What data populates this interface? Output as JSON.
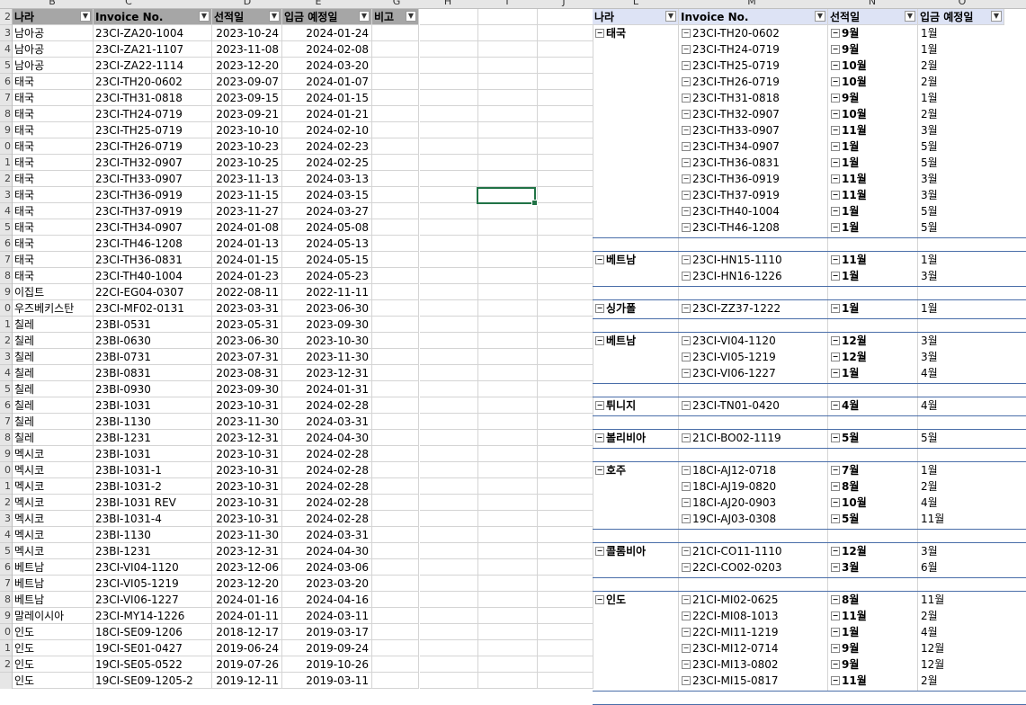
{
  "column_letters": [
    "B",
    "C",
    "D",
    "E",
    "G",
    "H",
    "I",
    "J",
    "L",
    "M",
    "N",
    "O"
  ],
  "row_numbers": [
    "2",
    "3",
    "4",
    "5",
    "6",
    "7",
    "8",
    "9",
    "0",
    "1",
    "2",
    "3",
    "4",
    "5",
    "6",
    "7",
    "8",
    "9",
    "0",
    "1",
    "2",
    "3",
    "4",
    "5",
    "6",
    "7",
    "8",
    "9",
    "0",
    "1",
    "2",
    "3",
    "4",
    "5",
    "6",
    "7",
    "8",
    "9",
    "0",
    "1",
    "2"
  ],
  "left_headers": [
    "나라",
    "Invoice No.",
    "선적일",
    "입금 예정일",
    "비고"
  ],
  "left_rows": [
    [
      "남아공",
      "23CI-ZA20-1004",
      "2023-10-24",
      "2024-01-24"
    ],
    [
      "남아공",
      "23CI-ZA21-1107",
      "2023-11-08",
      "2024-02-08"
    ],
    [
      "남아공",
      "23CI-ZA22-1114",
      "2023-12-20",
      "2024-03-20"
    ],
    [
      "태국",
      "23CI-TH20-0602",
      "2023-09-07",
      "2024-01-07"
    ],
    [
      "태국",
      "23CI-TH31-0818",
      "2023-09-15",
      "2024-01-15"
    ],
    [
      "태국",
      "23CI-TH24-0719",
      "2023-09-21",
      "2024-01-21"
    ],
    [
      "태국",
      "23CI-TH25-0719",
      "2023-10-10",
      "2024-02-10"
    ],
    [
      "태국",
      "23CI-TH26-0719",
      "2023-10-23",
      "2024-02-23"
    ],
    [
      "태국",
      "23CI-TH32-0907",
      "2023-10-25",
      "2024-02-25"
    ],
    [
      "태국",
      "23CI-TH33-0907",
      "2023-11-13",
      "2024-03-13"
    ],
    [
      "태국",
      "23CI-TH36-0919",
      "2023-11-15",
      "2024-03-15"
    ],
    [
      "태국",
      "23CI-TH37-0919",
      "2023-11-27",
      "2024-03-27"
    ],
    [
      "태국",
      "23CI-TH34-0907",
      "2024-01-08",
      "2024-05-08"
    ],
    [
      "태국",
      "23CI-TH46-1208",
      "2024-01-13",
      "2024-05-13"
    ],
    [
      "태국",
      "23CI-TH36-0831",
      "2024-01-15",
      "2024-05-15"
    ],
    [
      "태국",
      "23CI-TH40-1004",
      "2024-01-23",
      "2024-05-23"
    ],
    [
      "이집트",
      "22CI-EG04-0307",
      "2022-08-11",
      "2022-11-11"
    ],
    [
      "우즈베키스탄",
      "23CI-MF02-0131",
      "2023-03-31",
      "2023-06-30"
    ],
    [
      "칠레",
      "23BI-0531",
      "2023-05-31",
      "2023-09-30"
    ],
    [
      "칠레",
      "23BI-0630",
      "2023-06-30",
      "2023-10-30"
    ],
    [
      "칠레",
      "23BI-0731",
      "2023-07-31",
      "2023-11-30"
    ],
    [
      "칠레",
      "23BI-0831",
      "2023-08-31",
      "2023-12-31"
    ],
    [
      "칠레",
      "23BI-0930",
      "2023-09-30",
      "2024-01-31"
    ],
    [
      "칠레",
      "23BI-1031",
      "2023-10-31",
      "2024-02-28"
    ],
    [
      "칠레",
      "23BI-1130",
      "2023-11-30",
      "2024-03-31"
    ],
    [
      "칠레",
      "23BI-1231",
      "2023-12-31",
      "2024-04-30"
    ],
    [
      "멕시코",
      "23BI-1031",
      "2023-10-31",
      "2024-02-28"
    ],
    [
      "멕시코",
      "23BI-1031-1",
      "2023-10-31",
      "2024-02-28"
    ],
    [
      "멕시코",
      "23BI-1031-2",
      "2023-10-31",
      "2024-02-28"
    ],
    [
      "멕시코",
      "23BI-1031 REV",
      "2023-10-31",
      "2024-02-28"
    ],
    [
      "멕시코",
      "23BI-1031-4",
      "2023-10-31",
      "2024-02-28"
    ],
    [
      "멕시코",
      "23BI-1130",
      "2023-11-30",
      "2024-03-31"
    ],
    [
      "멕시코",
      "23BI-1231",
      "2023-12-31",
      "2024-04-30"
    ],
    [
      "베트남",
      "23CI-VI04-1120",
      "2023-12-06",
      "2024-03-06"
    ],
    [
      "베트남",
      "23CI-VI05-1219",
      "2023-12-20",
      "2023-03-20"
    ],
    [
      "베트남",
      "23CI-VI06-1227",
      "2024-01-16",
      "2024-04-16"
    ],
    [
      "말레이시아",
      "23CI-MY14-1226",
      "2024-01-11",
      "2024-03-11"
    ],
    [
      "인도",
      "18CI-SE09-1206",
      "2018-12-17",
      "2019-03-17"
    ],
    [
      "인도",
      "19CI-SE01-0427",
      "2019-06-24",
      "2019-09-24"
    ],
    [
      "인도",
      "19CI-SE05-0522",
      "2019-07-26",
      "2019-10-26"
    ],
    [
      "인도",
      "19CI-SE09-1205-2",
      "2019-12-11",
      "2019-03-11"
    ]
  ],
  "pivot_headers": [
    "나라",
    "Invoice No.",
    "선적일",
    "입금 예정일"
  ],
  "pivot_groups": [
    {
      "country": "태국",
      "rows": [
        [
          "23CI-TH20-0602",
          "9월",
          "1월"
        ],
        [
          "23CI-TH24-0719",
          "9월",
          "1월"
        ],
        [
          "23CI-TH25-0719",
          "10월",
          "2월"
        ],
        [
          "23CI-TH26-0719",
          "10월",
          "2월"
        ],
        [
          "23CI-TH31-0818",
          "9월",
          "1월"
        ],
        [
          "23CI-TH32-0907",
          "10월",
          "2월"
        ],
        [
          "23CI-TH33-0907",
          "11월",
          "3월"
        ],
        [
          "23CI-TH34-0907",
          "1월",
          "5월"
        ],
        [
          "23CI-TH36-0831",
          "1월",
          "5월"
        ],
        [
          "23CI-TH36-0919",
          "11월",
          "3월"
        ],
        [
          "23CI-TH37-0919",
          "11월",
          "3월"
        ],
        [
          "23CI-TH40-1004",
          "1월",
          "5월"
        ],
        [
          "23CI-TH46-1208",
          "1월",
          "5월"
        ]
      ]
    },
    {
      "country": "베트남",
      "rows": [
        [
          "23CI-HN15-1110",
          "11월",
          "1월"
        ],
        [
          "23CI-HN16-1226",
          "1월",
          "3월"
        ]
      ]
    },
    {
      "country": "싱가폴",
      "rows": [
        [
          "23CI-ZZ37-1222",
          "1월",
          "1월"
        ]
      ]
    },
    {
      "country": "베트남",
      "rows": [
        [
          "23CI-VI04-1120",
          "12월",
          "3월"
        ],
        [
          "23CI-VI05-1219",
          "12월",
          "3월"
        ],
        [
          "23CI-VI06-1227",
          "1월",
          "4월"
        ]
      ]
    },
    {
      "country": "튀니지",
      "rows": [
        [
          "23CI-TN01-0420",
          "4월",
          "4월"
        ]
      ]
    },
    {
      "country": "볼리비아",
      "rows": [
        [
          "21CI-BO02-1119",
          "5월",
          "5월"
        ]
      ]
    },
    {
      "country": "호주",
      "rows": [
        [
          "18CI-AJ12-0718",
          "7월",
          "1월"
        ],
        [
          "18CI-AJ19-0820",
          "8월",
          "2월"
        ],
        [
          "18CI-AJ20-0903",
          "10월",
          "4월"
        ],
        [
          "19CI-AJ03-0308",
          "5월",
          "11월"
        ]
      ]
    },
    {
      "country": "콜롬비아",
      "rows": [
        [
          "21CI-CO11-1110",
          "12월",
          "3월"
        ],
        [
          "22CI-CO02-0203",
          "3월",
          "6월"
        ]
      ]
    },
    {
      "country": "인도",
      "rows": [
        [
          "21CI-MI02-0625",
          "8월",
          "11월"
        ],
        [
          "22CI-MI08-1013",
          "11월",
          "2월"
        ],
        [
          "22CI-MI11-1219",
          "1월",
          "4월"
        ],
        [
          "23CI-MI12-0714",
          "9월",
          "12월"
        ],
        [
          "23CI-MI13-0802",
          "9월",
          "12월"
        ],
        [
          "23CI-MI15-0817",
          "11월",
          "2월"
        ]
      ]
    }
  ],
  "icons": {
    "filter": "filter-dropdown-icon",
    "collapse": "collapse-minus-icon"
  },
  "colors": {
    "header_gray": "#a6a6a6",
    "pivot_header": "#dde3f5",
    "pivot_line": "#4a6ea9",
    "selection": "#217346"
  }
}
